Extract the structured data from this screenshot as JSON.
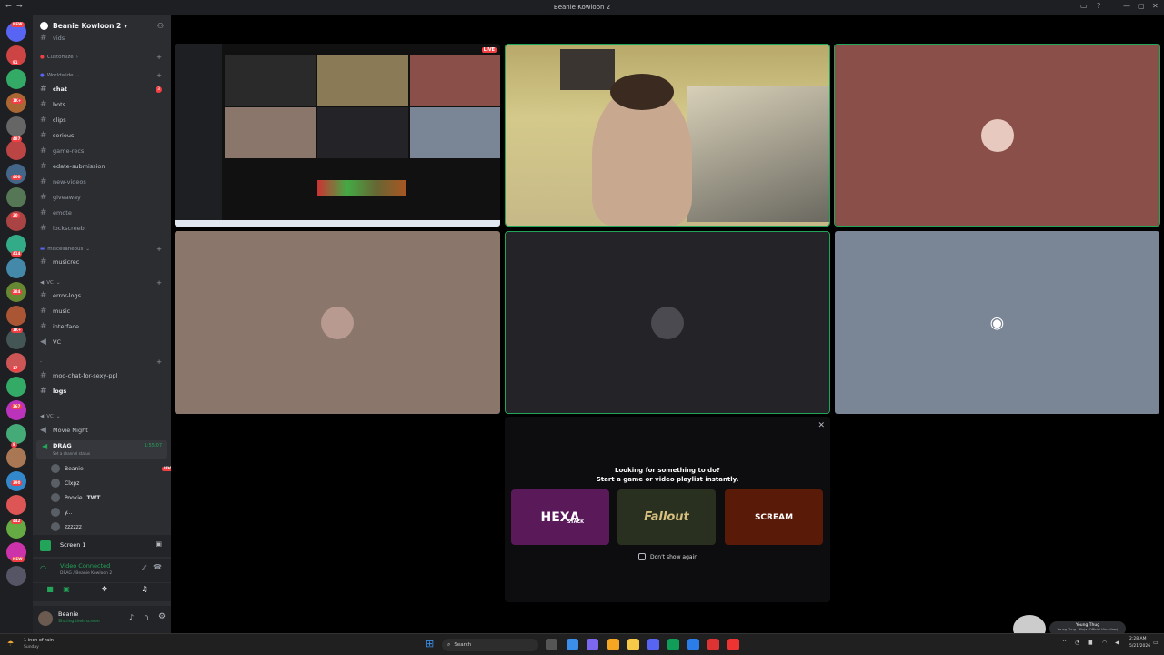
{
  "window": {
    "title": "Beanie Kowloon 2"
  },
  "server": {
    "name": "Beanie Kowloon 2",
    "chevron": "▾"
  },
  "server_badges": [
    "NEW",
    "91",
    "1K+",
    "487",
    "400",
    "20",
    "414",
    "284",
    "1K+",
    "17",
    "367",
    "8",
    "390",
    "442",
    "NEW"
  ],
  "categories": {
    "customize": "Customize",
    "worldwide": "Worldwide",
    "miscellaneous": "miscellaneous",
    "vc": "VC",
    "mod": "-",
    "vc2": "VC"
  },
  "channels": {
    "vids": "vids",
    "chat": "chat",
    "chat_badge": "3",
    "bots": "bots",
    "clips": "clips",
    "serious": "serious",
    "game_recs": "game-recs",
    "edate": "edate-submission",
    "new_videos": "new-videos",
    "giveaway": "giveaway",
    "emote": "emote",
    "lockscreeb": "lockscreeb",
    "musicrec": "musicrec",
    "error_logs": "error-logs",
    "music": "music",
    "interface": "interface",
    "vc": "VC",
    "mod_chat": "mod-chat-for-sexy-ppl",
    "logs": "logs",
    "movie_night": "Movie Night",
    "drag": "DRAG",
    "drag_timer": "1:55:07",
    "drag_status": "Set a channel status"
  },
  "voice_members": [
    {
      "name": "Beanie",
      "live": "LIVE"
    },
    {
      "name": "Clxpz",
      "live": ""
    },
    {
      "name": "Pookie",
      "extra": "TWT",
      "live": ""
    },
    {
      "name": "y...",
      "live": ""
    },
    {
      "name": "zzzzzz",
      "live": ""
    }
  ],
  "screen_panel": {
    "label": "Screen 1"
  },
  "voice_panel": {
    "status": "Video Connected",
    "sub": "DRAG / Beanie Kowloon 2"
  },
  "user_panel": {
    "name": "Beanie",
    "status": "Sharing their screen"
  },
  "stream_tile": {
    "live": "LIVE"
  },
  "promo": {
    "line1": "Looking for something to do?",
    "line2": "Start a game or video playlist instantly.",
    "checkbox_label": "Don't show again",
    "games": [
      {
        "title": "HEXA",
        "sub": "STACK",
        "bg": "#5a1a5a"
      },
      {
        "title": "Fallout",
        "sub": "",
        "bg": "#2a3020"
      },
      {
        "title": "SCREAM",
        "sub": "",
        "bg": "#5a1a08"
      }
    ]
  },
  "now_playing": {
    "title": "Young Thug",
    "sub": "Young Thug - Ninja (Official Visualizer)"
  },
  "taskbar": {
    "weather": "1 inch of rain",
    "weather_sub": "Sunday",
    "search": "Search",
    "time": "2:28 AM",
    "date": "5/21/2026"
  },
  "colors": {
    "accent_green": "#23a559",
    "red": "#f23f43",
    "tile_rose": "#8b4f4a",
    "tile_tan": "#8a766b",
    "tile_dark": "#232328",
    "tile_gray": "#7a8595"
  }
}
